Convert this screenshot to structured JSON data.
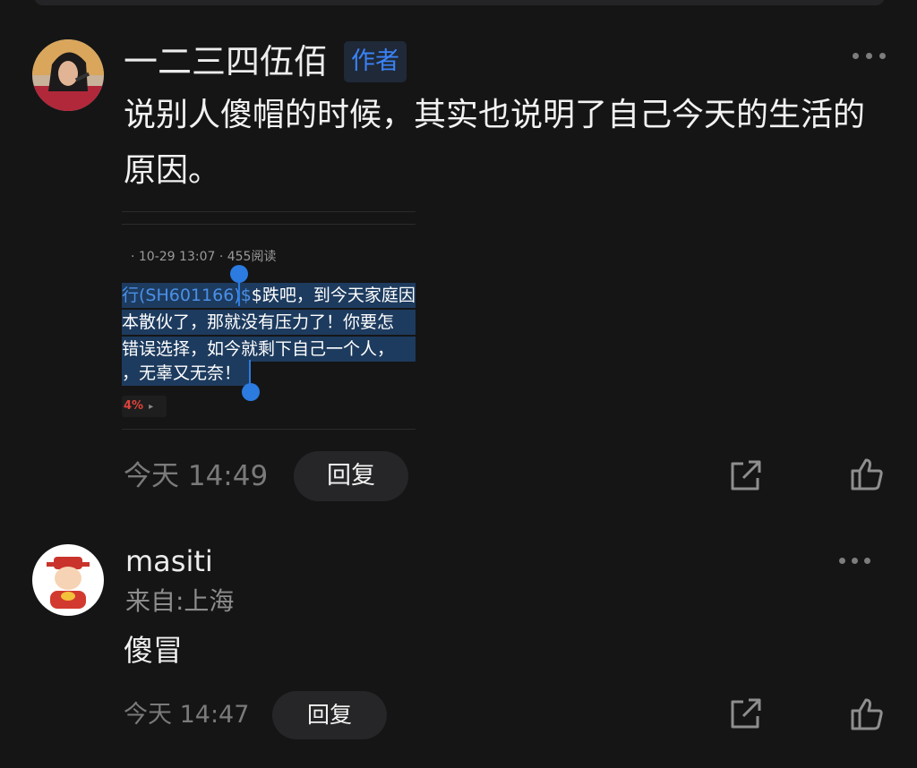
{
  "comments": [
    {
      "username": "一二三四伍佰",
      "badge": "作者",
      "text": "说别人傻帽的时候，其实也说明了自己今天的生活的原因。",
      "time": "今天 14:49",
      "reply_label": "回复",
      "quote": {
        "meta": "· 10-29 13:07 · 455阅读",
        "lines": [
          "$跌吧，到今天家庭因为",
          "本散伙了，那就没有压力了！你要怎",
          "错误选择，如今就剩下自己一个人，",
          "，无辜又无奈！"
        ],
        "stock_link": "行(SH601166)$",
        "percent": "4%"
      }
    },
    {
      "username": "masiti",
      "location": "来自:上海",
      "text": "傻冒",
      "time": "今天 14:47",
      "reply_label": "回复"
    }
  ],
  "icons": [
    "more-icon",
    "share-icon",
    "like-icon"
  ],
  "colors": {
    "background": "#151516",
    "accent": "#2b7be0",
    "badge_text": "#3b82f6"
  }
}
